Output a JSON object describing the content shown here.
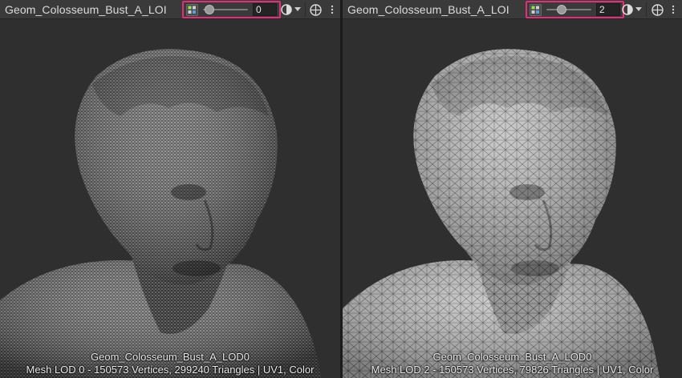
{
  "left_panel": {
    "title": "Geom_Colosseum_Bust_A_LOI",
    "lod_value": "0",
    "slider_fraction": 0.05,
    "caption_line1": "Geom_Colosseum_Bust_A_LOD0",
    "caption_line2": "Mesh LOD 0 - 150573 Vertices, 299240 Triangles | UV1, Color"
  },
  "right_panel": {
    "title": "Geom_Colosseum_Bust_A_LOI",
    "lod_value": "2",
    "slider_fraction": 0.3,
    "caption_line1": "Geom_Colosseum_Bust_A_LOD0",
    "caption_line2": "Mesh LOD 2 - 150573 Vertices, 79826 Triangles | UV1, Color"
  },
  "icons": {
    "lod": "lod-icon",
    "shading": "shading-mode-icon",
    "dropdown": "chevron-down-icon",
    "gizmo": "gizmo-icon",
    "menu": "kebab-menu-icon"
  },
  "colors": {
    "highlight": "#e0307a",
    "toolbar": "#3a3a3a",
    "viewport": "#2f2f2f"
  }
}
